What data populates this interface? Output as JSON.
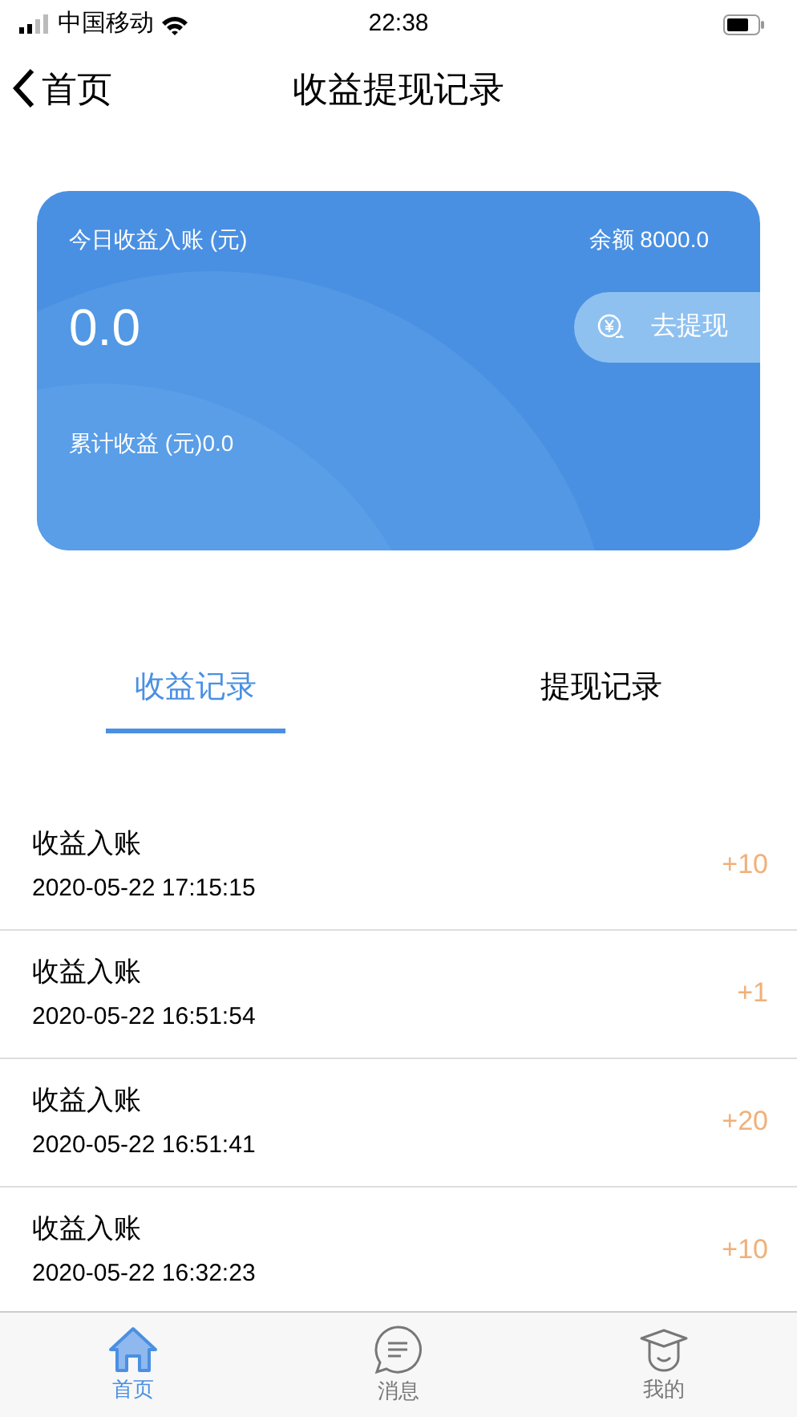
{
  "status_bar": {
    "carrier": "中国移动",
    "time": "22:38"
  },
  "nav": {
    "back_label": "首页",
    "title": "收益提现记录"
  },
  "card": {
    "today_label": "今日收益入账 (元)",
    "balance": "余额 8000.0",
    "today_value": "0.0",
    "withdraw_button": "去提现",
    "total": "累计收益 (元)0.0"
  },
  "tabs": [
    {
      "label": "收益记录",
      "selected": true
    },
    {
      "label": "提现记录",
      "selected": false
    }
  ],
  "records": [
    {
      "title": "收益入账",
      "time": "2020-05-22 17:15:15",
      "amount": "+10"
    },
    {
      "title": "收益入账",
      "time": "2020-05-22 16:51:54",
      "amount": "+1"
    },
    {
      "title": "收益入账",
      "time": "2020-05-22 16:51:41",
      "amount": "+20"
    },
    {
      "title": "收益入账",
      "time": "2020-05-22 16:32:23",
      "amount": "+10"
    }
  ],
  "tab_bar": [
    {
      "label": "首页",
      "kind": "home",
      "selected": true
    },
    {
      "label": "消息",
      "kind": "message",
      "selected": false
    },
    {
      "label": "我的",
      "kind": "profile",
      "selected": false
    }
  ]
}
